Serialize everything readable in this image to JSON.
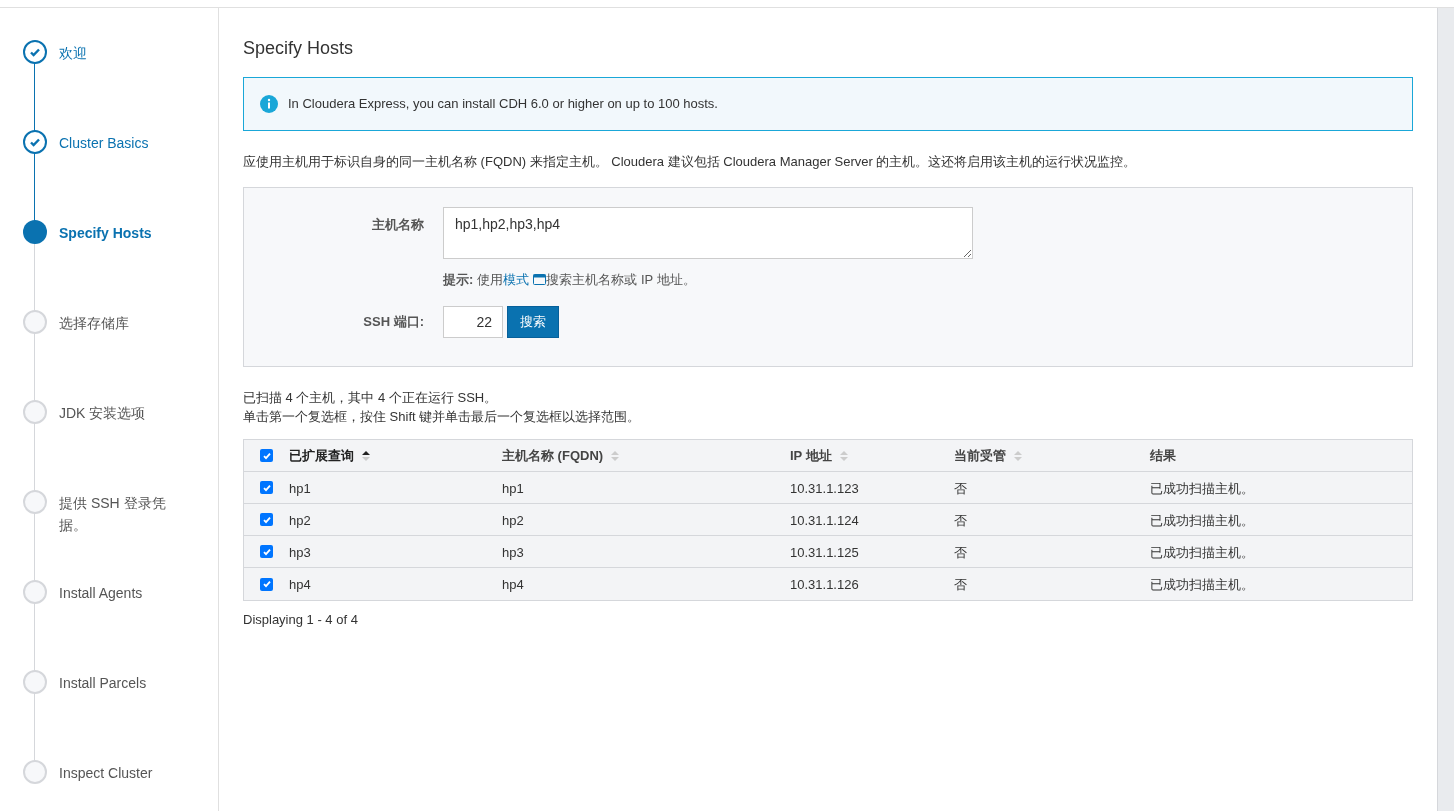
{
  "steps": [
    {
      "label": "欢迎",
      "kind": "done"
    },
    {
      "label": "Cluster Basics",
      "kind": "done"
    },
    {
      "label": "Specify Hosts",
      "kind": "current"
    },
    {
      "label": "选择存储库",
      "kind": "pending"
    },
    {
      "label": "JDK 安装选项",
      "kind": "pending"
    },
    {
      "label": "提供 SSH 登录凭据。",
      "kind": "pending"
    },
    {
      "label": "Install Agents",
      "kind": "pending"
    },
    {
      "label": "Install Parcels",
      "kind": "pending"
    },
    {
      "label": "Inspect Cluster",
      "kind": "pending"
    }
  ],
  "page_title": "Specify Hosts",
  "info_alert": "In Cloudera Express, you can install CDH 6.0 or higher on up to 100 hosts.",
  "description": "应使用主机用于标识自身的同一主机名称 (FQDN) 来指定主机。 Cloudera 建议包括 Cloudera Manager Server 的主机。这还将启用该主机的运行状况监控。",
  "form": {
    "hostname_label": "主机名称",
    "hostname_value": "hp1,hp2,hp3,hp4",
    "hint_label": "提示:",
    "hint_prefix": "使用",
    "hint_link": "模式",
    "hint_suffix": "搜索主机名称或 IP 地址。",
    "ssh_port_label": "SSH 端口:",
    "ssh_port_value": "22",
    "search_button": "搜索"
  },
  "scan_summary": "已扫描 4 个主机，其中 4 个正在运行 SSH。",
  "scan_tip": "单击第一个复选框，按住 Shift 键并单击最后一个复选框以选择范围。",
  "table": {
    "select_all": true,
    "columns": [
      {
        "label": "已扩展查询",
        "sortable": true,
        "sorted": true
      },
      {
        "label": "主机名称 (FQDN)",
        "sortable": true,
        "sorted": false
      },
      {
        "label": "IP 地址",
        "sortable": true,
        "sorted": false
      },
      {
        "label": "当前受管",
        "sortable": true,
        "sorted": false
      },
      {
        "label": "结果",
        "sortable": false,
        "sorted": false
      }
    ],
    "rows": [
      {
        "checked": true,
        "cells": [
          "hp1",
          "hp1",
          "10.31.1.123",
          "否",
          "已成功扫描主机。"
        ]
      },
      {
        "checked": true,
        "cells": [
          "hp2",
          "hp2",
          "10.31.1.124",
          "否",
          "已成功扫描主机。"
        ]
      },
      {
        "checked": true,
        "cells": [
          "hp3",
          "hp3",
          "10.31.1.125",
          "否",
          "已成功扫描主机。"
        ]
      },
      {
        "checked": true,
        "cells": [
          "hp4",
          "hp4",
          "10.31.1.126",
          "否",
          "已成功扫描主机。"
        ]
      }
    ]
  },
  "pagination": "Displaying 1 - 4 of 4"
}
